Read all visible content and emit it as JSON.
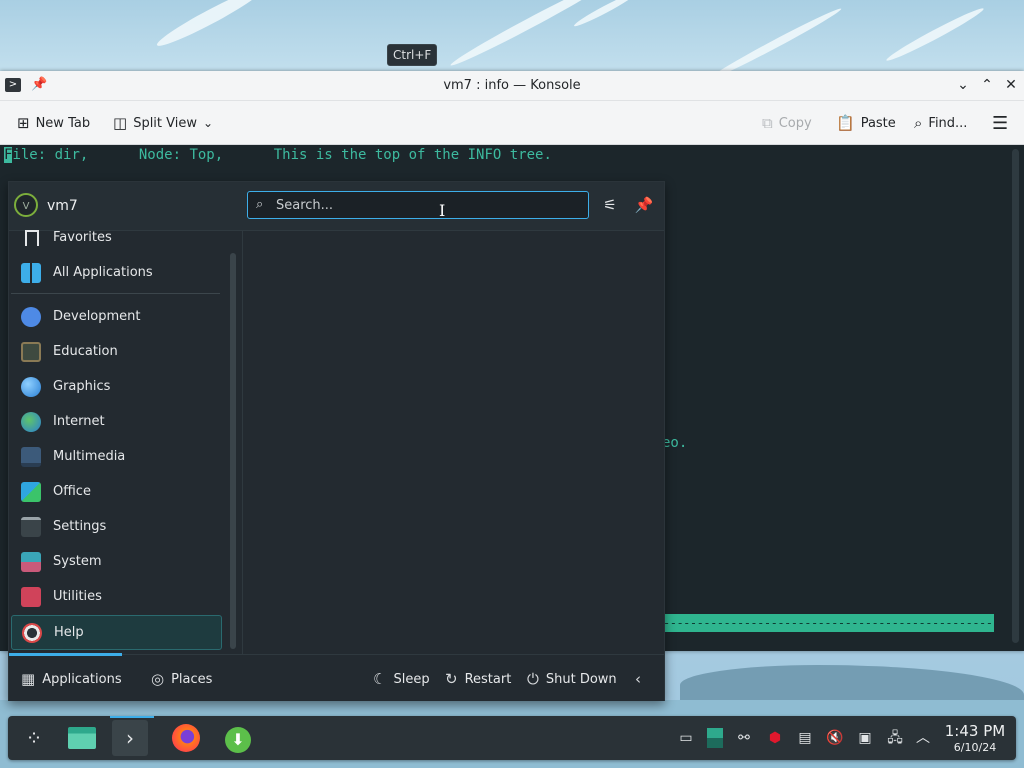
{
  "window": {
    "title": "vm7 : info — Konsole",
    "icons": {
      "app": "terminal-icon",
      "pin": "pin-icon",
      "minimize": "chevron-down-icon",
      "maximize": "chevron-up-icon",
      "close": "close-icon"
    }
  },
  "toolbar": {
    "new_tab": "New Tab",
    "split_view": "Split View",
    "copy": "Copy",
    "paste": "Paste",
    "find": "Find..."
  },
  "terminal": {
    "cursor_char": "F",
    "line1": "ile: dir,      Node: Top,      This is the top of the INFO tree.",
    "visible_right_text": "eo.",
    "status_line": "--------------------------------------------------------------",
    "colors": {
      "bg": "#1c262b",
      "text": "#3dba9f"
    }
  },
  "menu": {
    "username": "vm7",
    "avatar_initial": "V",
    "search_placeholder": "Search...",
    "search_tooltip": "Ctrl+F",
    "sidebar": [
      {
        "label": "Favorites",
        "icon": "bookmark-icon"
      },
      {
        "label": "All Applications",
        "icon": "grid-icon"
      },
      {
        "label": "Development",
        "icon": "development-icon"
      },
      {
        "label": "Education",
        "icon": "education-icon"
      },
      {
        "label": "Graphics",
        "icon": "graphics-icon"
      },
      {
        "label": "Internet",
        "icon": "globe-icon"
      },
      {
        "label": "Multimedia",
        "icon": "multimedia-icon"
      },
      {
        "label": "Office",
        "icon": "office-icon"
      },
      {
        "label": "Settings",
        "icon": "settings-icon"
      },
      {
        "label": "System",
        "icon": "system-icon"
      },
      {
        "label": "Utilities",
        "icon": "utilities-icon"
      },
      {
        "label": "Help",
        "icon": "help-icon"
      }
    ],
    "selected_item": "Help",
    "footer": {
      "applications": "Applications",
      "places": "Places",
      "sleep": "Sleep",
      "restart": "Restart",
      "shutdown": "Shut Down"
    }
  },
  "panel": {
    "launchers": [
      "app-launcher-icon",
      "file-manager-icon",
      "konsole-icon",
      "firefox-icon",
      "discover-icon"
    ],
    "tray": [
      "show-desktop-icon",
      "vault-icon",
      "kde-connect-icon",
      "update-shield-icon",
      "clipboard-icon",
      "audio-muted-icon",
      "disks-icon",
      "network-icon",
      "expand-tray-icon"
    ],
    "clock": {
      "time": "1:43 PM",
      "date": "6/10/24"
    }
  },
  "colors": {
    "accent": "#3daee9",
    "menu_bg": "#232a30",
    "panel_bg": "#2a3237",
    "terminal_green": "#3dba9f"
  }
}
